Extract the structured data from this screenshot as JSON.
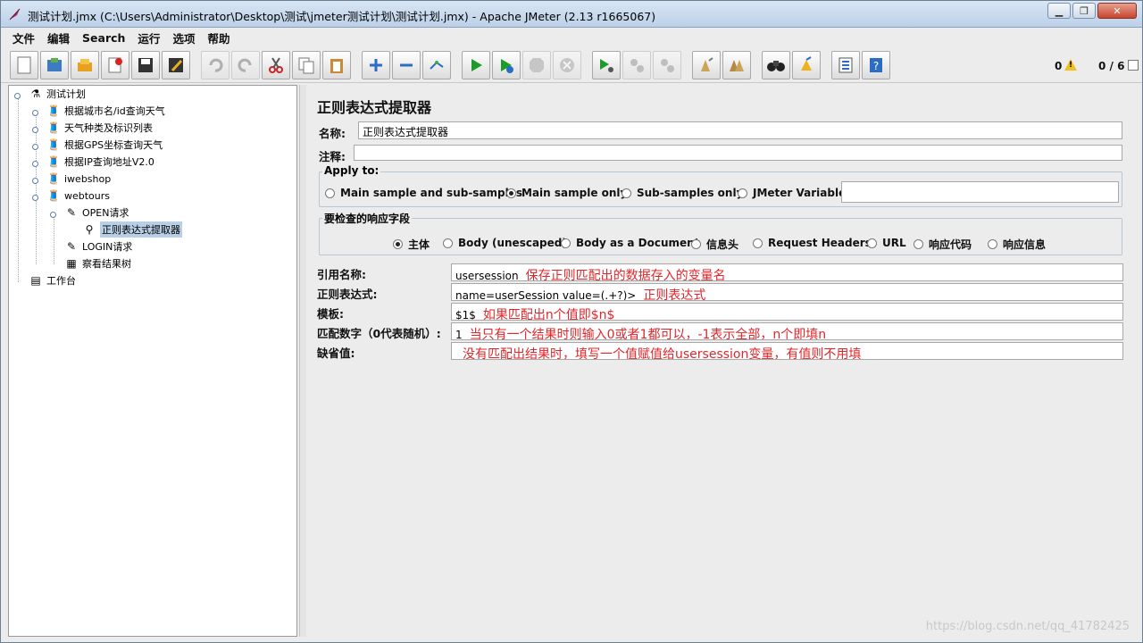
{
  "window": {
    "title": "测试计划.jmx (C:\\Users\\Administrator\\Desktop\\测试\\jmeter测试计划\\测试计划.jmx) - Apache JMeter (2.13 r1665067)"
  },
  "menu": [
    "文件",
    "编辑",
    "Search",
    "运行",
    "选项",
    "帮助"
  ],
  "toolbar": {
    "error_count": "0",
    "thread_count": "0 / 6"
  },
  "tree": {
    "root": "测试计划",
    "items": [
      "根据城市名/id查询天气",
      "天气种类及标识列表",
      "根据GPS坐标查询天气",
      "根据IP查询地址V2.0",
      "iwebshop",
      "webtours",
      "OPEN请求",
      "正则表达式提取器",
      "LOGIN请求",
      "察看结果树"
    ],
    "workbench": "工作台"
  },
  "panel": {
    "title": "正则表达式提取器",
    "name_label": "名称:",
    "name_value": "正则表达式提取器",
    "comment_label": "注释:",
    "comment_value": "",
    "apply_to": {
      "title": "Apply to:",
      "options": [
        "Main sample and sub-samples",
        "Main sample only",
        "Sub-samples only",
        "JMeter Variable"
      ],
      "selected": 1,
      "variable_value": ""
    },
    "response_field": {
      "title": "要检查的响应字段",
      "options": [
        "主体",
        "Body (unescaped)",
        "Body as a Document",
        "信息头",
        "Request Headers",
        "URL",
        "响应代码",
        "响应信息"
      ],
      "selected": 0
    },
    "ref_name": {
      "label": "引用名称:",
      "value": "usersession",
      "note": "保存正则匹配出的数据存入的变量名"
    },
    "regex": {
      "label": "正则表达式:",
      "value": "name=userSession value=(.+?)>",
      "note": "正则表达式"
    },
    "template": {
      "label": "模板:",
      "value": "$1$",
      "note": "如果匹配出n个值即$n$"
    },
    "match_no": {
      "label": "匹配数字（0代表随机）:",
      "value": "1",
      "note": "当只有一个结果时则输入0或者1都可以，-1表示全部，n个即填n"
    },
    "default": {
      "label": "缺省值:",
      "value": "",
      "note": "没有匹配出结果时，填写一个值赋值给usersession变量，有值则不用填"
    }
  },
  "watermark": "https://blog.csdn.net/qq_41782425"
}
